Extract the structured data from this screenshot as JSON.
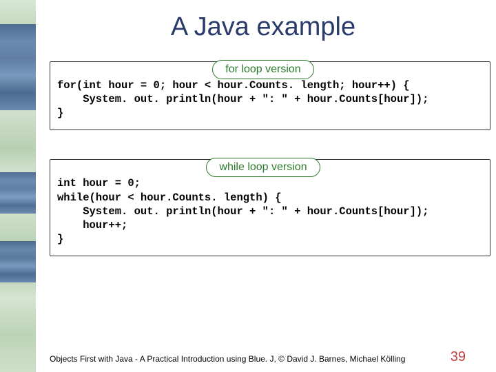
{
  "title": "A Java example",
  "labels": {
    "for": "for loop version",
    "while": "while loop version"
  },
  "code": {
    "for": "for(int hour = 0; hour < hour.Counts. length; hour++) {\n    System. out. println(hour + \": \" + hour.Counts[hour]);\n}",
    "while": "int hour = 0;\nwhile(hour < hour.Counts. length) {\n    System. out. println(hour + \": \" + hour.Counts[hour]);\n    hour++;\n}"
  },
  "footer": "Objects First with Java - A Practical Introduction using Blue. J, © David J. Barnes, Michael Kölling",
  "page": "39"
}
